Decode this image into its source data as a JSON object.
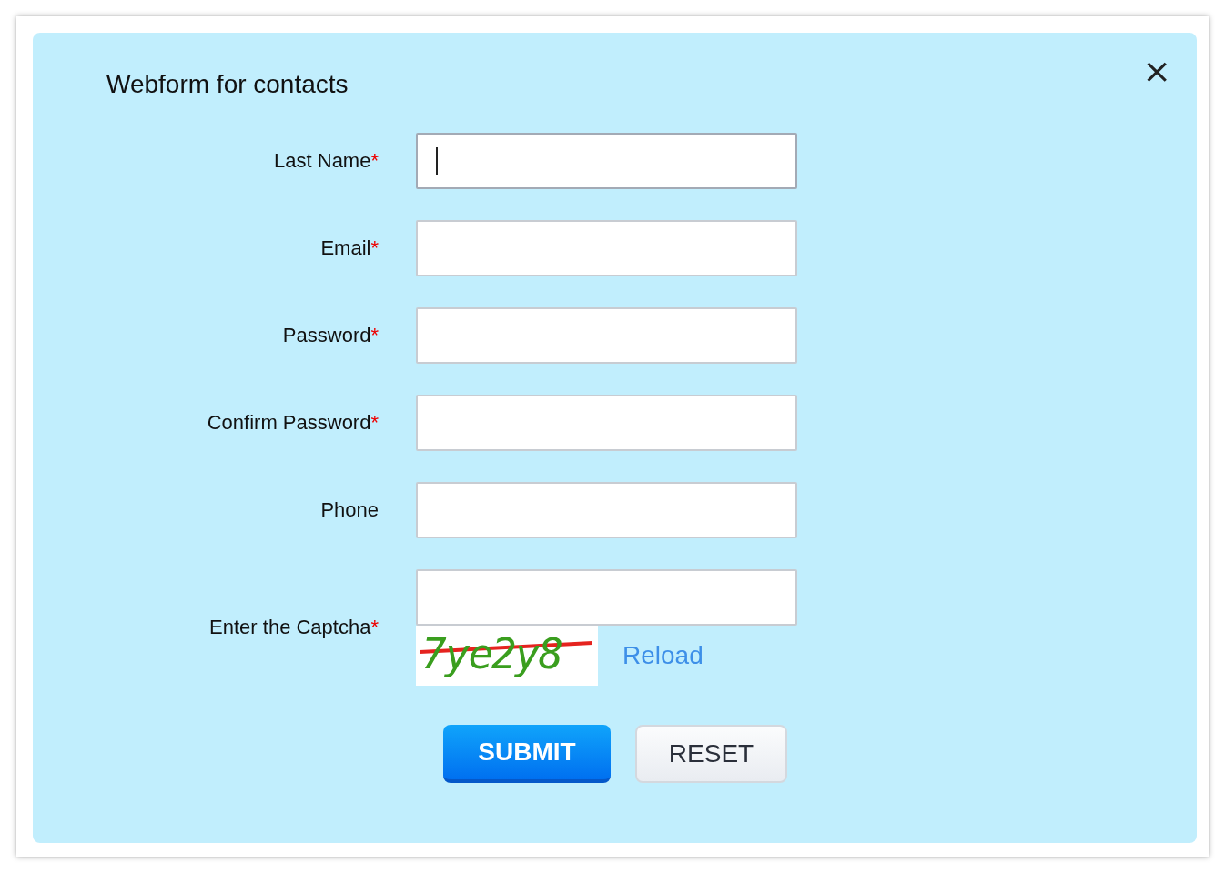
{
  "title": "Webform for contacts",
  "close": "×",
  "fields": [
    {
      "label": "Last Name",
      "required_mark": "*",
      "focused": true
    },
    {
      "label": "Email",
      "required_mark": "*",
      "focused": false
    },
    {
      "label": "Password",
      "required_mark": "*",
      "focused": false
    },
    {
      "label": "Confirm Password",
      "required_mark": "*",
      "focused": false
    },
    {
      "label": "Phone",
      "focused": false
    }
  ],
  "captcha": {
    "label": "Enter the Captcha",
    "required_mark": "*",
    "code": "7ye2y8",
    "reload": "Reload"
  },
  "buttons": [
    {
      "label": "SUBMIT",
      "kind": "primary"
    },
    {
      "label": "RESET",
      "kind": "secondary"
    }
  ]
}
